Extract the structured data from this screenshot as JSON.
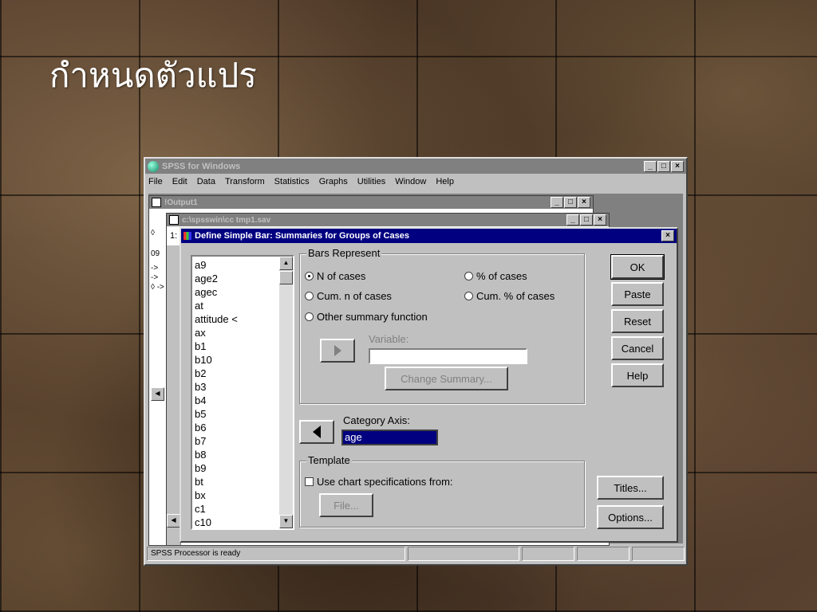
{
  "slide": {
    "title": "กำหนดตัวแปร"
  },
  "spss": {
    "title": "SPSS for Windows",
    "menu": [
      "File",
      "Edit",
      "Data",
      "Transform",
      "Statistics",
      "Graphs",
      "Utilities",
      "Window",
      "Help"
    ],
    "output_title": "!Output1",
    "data_title": "c:\\spsswin\\cc    tmp1.sav",
    "side_labels": [
      "◊",
      "09",
      "->",
      "->",
      "◊ ->"
    ],
    "row_label": "1:",
    "status": "SPSS Processor is ready"
  },
  "dialog": {
    "title": "Define Simple Bar: Summaries for Groups of Cases",
    "variables": [
      "a9",
      "age2",
      "agec",
      "at",
      "attitude <",
      "ax",
      "b1",
      "b10",
      "b2",
      "b3",
      "b4",
      "b5",
      "b6",
      "b7",
      "b8",
      "b9",
      "bt",
      "bx",
      "c1",
      "c10"
    ],
    "bars_represent": {
      "legend": "Bars Represent",
      "n_cases": "N of cases",
      "pct_cases": "% of cases",
      "cum_n": "Cum. n of cases",
      "cum_pct": "Cum. % of cases",
      "other": "Other summary function",
      "variable_label": "Variable:",
      "change_summary": "Change Summary..."
    },
    "category_axis": {
      "label": "Category Axis:",
      "value": "age"
    },
    "template": {
      "legend": "Template",
      "use_spec": "Use chart specifications from:",
      "file": "File..."
    },
    "buttons": {
      "ok": "OK",
      "paste": "Paste",
      "reset": "Reset",
      "cancel": "Cancel",
      "help": "Help",
      "titles": "Titles...",
      "options": "Options..."
    }
  }
}
